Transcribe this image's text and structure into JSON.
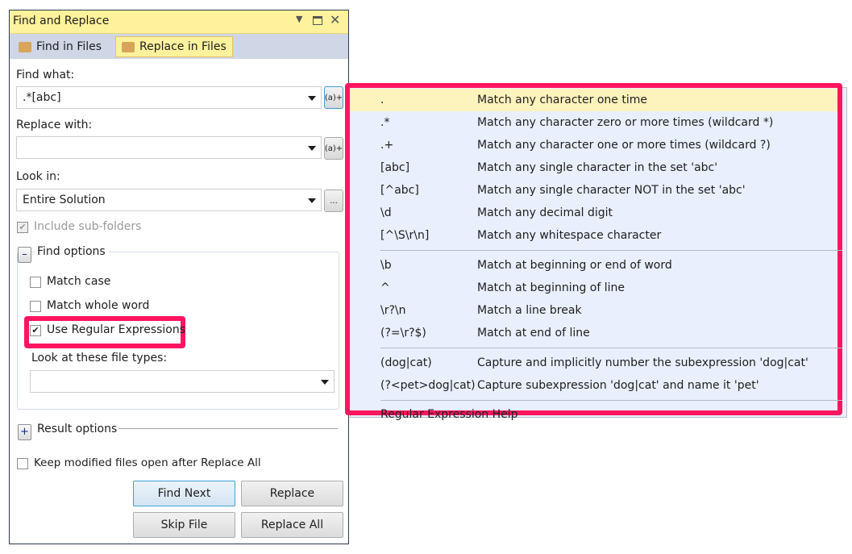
{
  "window": {
    "title": "Find and Replace",
    "buttons": [
      "dropdown",
      "maximize",
      "close"
    ]
  },
  "tabs": [
    {
      "label": "Find in Files",
      "icon": "find-in-files-icon",
      "selected": false
    },
    {
      "label": "Replace in Files",
      "icon": "replace-in-files-icon",
      "selected": true
    }
  ],
  "find": {
    "label": "Find what:",
    "value": ".*[abc]",
    "builder_label": "(a)+"
  },
  "replace": {
    "label": "Replace with:",
    "value": "",
    "builder_label": "(a)+"
  },
  "look_in": {
    "label": "Look in:",
    "value": "Entire Solution",
    "browse_label": "..."
  },
  "include_subfolders": {
    "label": "Include sub-folders",
    "checked": true,
    "disabled": true
  },
  "find_options": {
    "label": "Find options",
    "expanded": true,
    "expander": "–",
    "match_case": {
      "label": "Match case",
      "checked": false
    },
    "match_whole_word": {
      "label": "Match whole word",
      "checked": false
    },
    "use_regex": {
      "label": "Use Regular Expressions",
      "checked": true,
      "check": "✔"
    },
    "file_types": {
      "label": "Look at these file types:",
      "value": ""
    }
  },
  "result_options": {
    "label": "Result options",
    "expanded": false,
    "expander": "+"
  },
  "keep_open": {
    "label": "Keep modified files open after Replace All",
    "checked": false
  },
  "buttons": {
    "find_next": "Find Next",
    "replace": "Replace",
    "skip_file": "Skip File",
    "replace_all": "Replace All"
  },
  "highlight_color": "#ff1560",
  "regex_menu": {
    "groups": [
      [
        {
          "expr": ".",
          "desc": "Match any character one time",
          "selected": true
        },
        {
          "expr": ".*",
          "desc": "Match any character zero or more times (wildcard *)"
        },
        {
          "expr": ".+",
          "desc": "Match any character one or more times (wildcard ?)"
        },
        {
          "expr": "[abc]",
          "desc": "Match any single character in the set 'abc'"
        },
        {
          "expr": "[^abc]",
          "desc": "Match any single character NOT in the set 'abc'"
        },
        {
          "expr": "\\d",
          "desc": "Match any decimal digit"
        },
        {
          "expr": "[^\\S\\r\\n]",
          "desc": "Match any whitespace character"
        }
      ],
      [
        {
          "expr": "\\b",
          "desc": "Match at beginning or end of word"
        },
        {
          "expr": "^",
          "desc": "Match at beginning of line"
        },
        {
          "expr": "\\r?\\n",
          "desc": "Match a line break"
        },
        {
          "expr": "(?=\\r?$)",
          "desc": "Match at end of line"
        }
      ],
      [
        {
          "expr": "(dog|cat)",
          "desc": "Capture and implicitly number the subexpression 'dog|cat'"
        },
        {
          "expr": "(?<pet>dog|cat)",
          "desc": "Capture subexpression 'dog|cat' and name it 'pet'"
        }
      ]
    ],
    "help": "Regular Expression Help"
  }
}
